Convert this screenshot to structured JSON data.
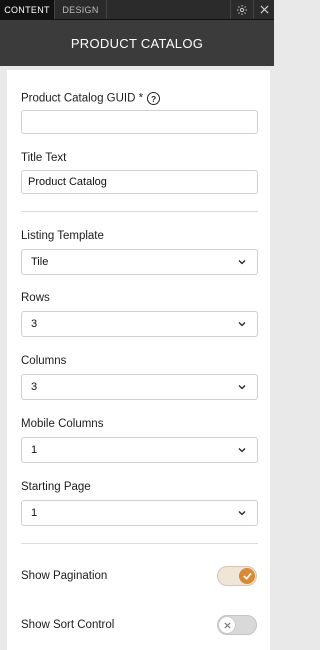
{
  "tabs": {
    "content": "CONTENT",
    "design": "DESIGN"
  },
  "header": {
    "title": "PRODUCT CATALOG"
  },
  "form": {
    "guid_label": "Product Catalog GUID *",
    "guid_help": "?",
    "guid_value": "",
    "title_text_label": "Title Text",
    "title_text_value": "Product Catalog",
    "listing_template_label": "Listing Template",
    "listing_template_value": "Tile",
    "rows_label": "Rows",
    "rows_value": "3",
    "columns_label": "Columns",
    "columns_value": "3",
    "mobile_columns_label": "Mobile Columns",
    "mobile_columns_value": "1",
    "starting_page_label": "Starting Page",
    "starting_page_value": "1",
    "show_pagination_label": "Show Pagination",
    "show_pagination_on": true,
    "show_sort_control_label": "Show Sort Control",
    "show_sort_control_on": false
  },
  "colors": {
    "accent": "#d98a36",
    "header_bg": "#3b3b3b",
    "tabbar_bg": "#2b2b2b"
  },
  "icons": {
    "settings": "gear-icon",
    "close": "close-icon",
    "dropdown": "chevron-down-icon",
    "check": "check-icon",
    "x": "x-icon"
  }
}
